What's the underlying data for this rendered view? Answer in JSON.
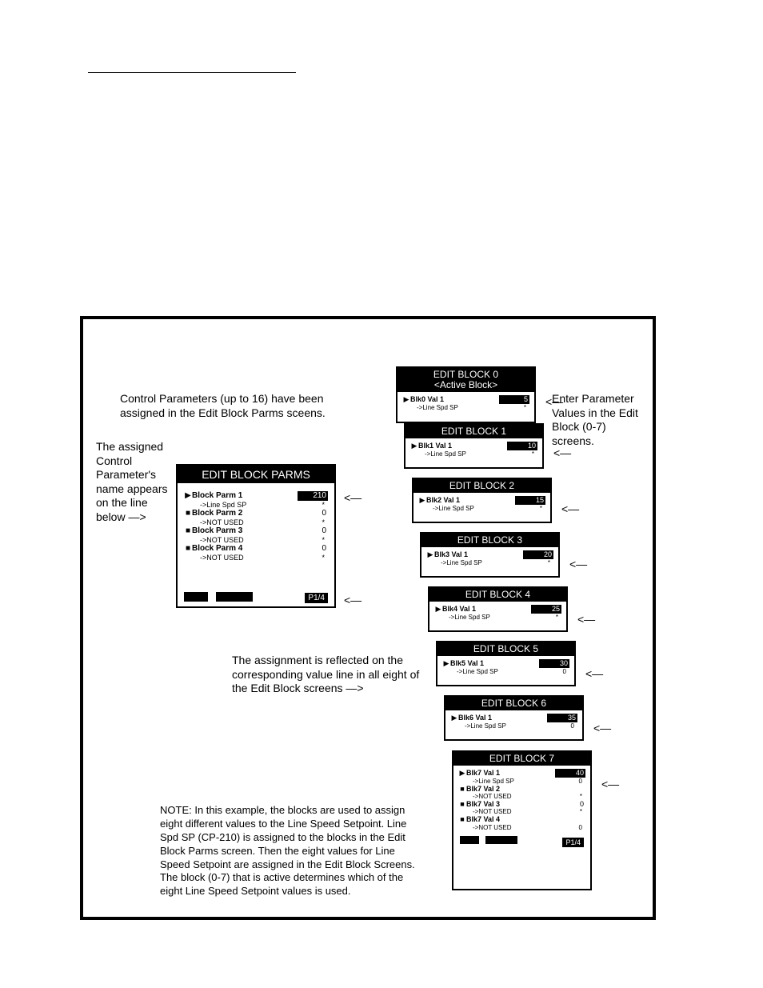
{
  "annotations": {
    "top_left": "Control Parameters (up to 16) have been assigned in the Edit Block Parms sceens.",
    "left_side": "The assigned Control Parameter's name appears on the line below —>",
    "mid": "The assignment is reflected on the corresponding value line in all eight of the Edit Block screens —>",
    "right": "Enter Parameter Values in the Edit Block (0-7) screens.",
    "note": "NOTE: In this example, the blocks are used to assign eight different values to the Line Speed Setpoint. Line Spd SP (CP-210) is assigned to the blocks in the Edit Block Parms screen.  Then the eight values for Line Speed Setpoint are assigned in the Edit Block Screens. The block (0-7) that is active determines which of the eight Line Speed Setpoint values is used."
  },
  "arrow_sym": "<—",
  "parms_panel": {
    "title": "EDIT BLOCK PARMS",
    "rows": [
      {
        "bullet": "▶",
        "label": "Block Parm 1",
        "value": "210",
        "hi": true,
        "sub": "->Line Spd SP",
        "star": "*"
      },
      {
        "bullet": "■",
        "label": "Block Parm 2",
        "value": "0",
        "hi": false,
        "sub": "->NOT USED",
        "star": "*"
      },
      {
        "bullet": "■",
        "label": "Block Parm 3",
        "value": "0",
        "hi": false,
        "sub": "->NOT USED",
        "star": "*"
      },
      {
        "bullet": "■",
        "label": "Block Parm 4",
        "value": "0",
        "hi": false,
        "sub": "->NOT USED",
        "star": "*"
      }
    ],
    "pager": "P1/4"
  },
  "blocks": [
    {
      "title": "EDIT BLOCK 0",
      "sub_title": "<Active Block>",
      "val_label": "Blk0 Val 1",
      "value": "5",
      "sub": "->Line Spd SP",
      "star": "*"
    },
    {
      "title": "EDIT BLOCK 1",
      "val_label": "Blk1 Val 1",
      "value": "10",
      "sub": "->Line Spd SP",
      "star": "*"
    },
    {
      "title": "EDIT BLOCK 2",
      "val_label": "Blk2 Val 1",
      "value": "15",
      "sub": "->Line Spd SP",
      "star": "*"
    },
    {
      "title": "EDIT BLOCK 3",
      "val_label": "Blk3 Val 1",
      "value": "20",
      "sub": "->Line Spd SP",
      "star": "*"
    },
    {
      "title": "EDIT BLOCK 4",
      "val_label": "Blk4 Val 1",
      "value": "25",
      "sub": "->Line Spd SP",
      "star": "*"
    },
    {
      "title": "EDIT BLOCK 5",
      "val_label": "Blk5 Val 1",
      "value": "30",
      "sub": "->Line Spd SP",
      "star": "0"
    },
    {
      "title": "EDIT BLOCK 6",
      "val_label": "Blk6 Val 1",
      "value": "35",
      "sub": "->Line Spd SP",
      "star": "0"
    }
  ],
  "block7": {
    "title": "EDIT BLOCK 7",
    "rows": [
      {
        "bullet": "▶",
        "label": "Blk7 Val 1",
        "value": "40",
        "hi": true,
        "sub": "->Line Spd SP",
        "star": "0"
      },
      {
        "bullet": "■",
        "label": "Blk7 Val 2",
        "value": "",
        "hi": false,
        "sub": "->NOT USED",
        "star": "*"
      },
      {
        "bullet": "■",
        "label": "Blk7 Val 3",
        "value": "0",
        "hi": false,
        "sub": "->NOT USED",
        "star": "*"
      },
      {
        "bullet": "■",
        "label": "Blk7 Val 4",
        "value": "",
        "hi": false,
        "sub": "->NOT USED",
        "star": "0"
      }
    ],
    "pager": "P1/4"
  }
}
